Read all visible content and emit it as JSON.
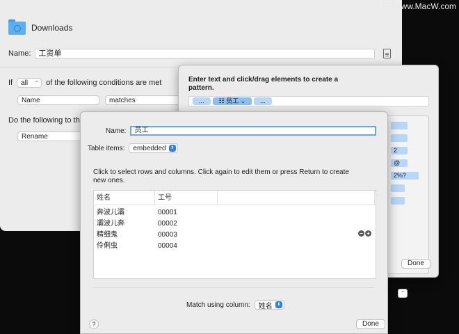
{
  "watermark": "www.MacW.com",
  "main": {
    "folder_title": "Downloads",
    "name_label": "Name:",
    "name_value": "工资单",
    "if_label": "If",
    "condition_scope": "all",
    "condition_text": "of the following conditions are met",
    "rule_attribute": "Name",
    "rule_operator": "matches",
    "action_label": "Do the following to the m",
    "action_value": "Rename"
  },
  "pattern": {
    "instruction": "Enter text and click/drag elements to create a pattern.",
    "tokens": [
      "...",
      "员工",
      "..."
    ],
    "chips": [
      "",
      "",
      "2",
      "@",
      "2%?",
      "",
      ""
    ],
    "done_label": "Done"
  },
  "table_sheet": {
    "name_label": "Name:",
    "name_value": "员工",
    "items_label": "Table items:",
    "items_value": "embedded",
    "instruction": "Click to select rows and columns. Click again to edit them or press Return to create new ones.",
    "columns": [
      "姓名",
      "工号",
      ""
    ],
    "rows": [
      [
        "奔波儿灞",
        "00001"
      ],
      [
        "灞波儿奔",
        "00002"
      ],
      [
        "精细鬼",
        "00003"
      ],
      [
        "伶俐虫",
        "00004"
      ]
    ],
    "match_label": "Match using column:",
    "match_value": "姓名",
    "help_label": "?",
    "done_label": "Done",
    "remove_label": "−",
    "add_label": "+"
  }
}
